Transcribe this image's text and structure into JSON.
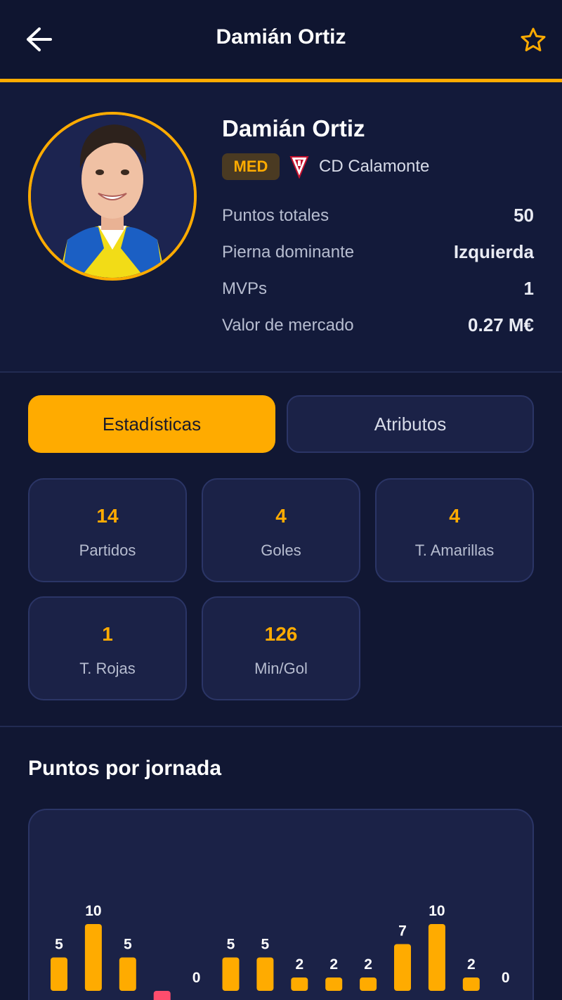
{
  "header": {
    "title": "Damián Ortiz",
    "back_icon": "arrow-left-icon",
    "favorite_icon": "star-outline-icon"
  },
  "profile": {
    "name": "Damián Ortiz",
    "position": "MED",
    "club": "CD Calamonte",
    "rows": [
      {
        "label": "Puntos totales",
        "value": "50"
      },
      {
        "label": "Pierna dominante",
        "value": "Izquierda"
      },
      {
        "label": "MVPs",
        "value": "1"
      },
      {
        "label": "Valor de mercado",
        "value": "0.27 M€"
      }
    ]
  },
  "tabs": [
    {
      "label": "Estadísticas",
      "active": true
    },
    {
      "label": "Atributos",
      "active": false
    }
  ],
  "stats": [
    {
      "value": "14",
      "label": "Partidos"
    },
    {
      "value": "4",
      "label": "Goles"
    },
    {
      "value": "4",
      "label": "T. Amarillas"
    },
    {
      "value": "1",
      "label": "T. Rojas"
    },
    {
      "value": "126",
      "label": "Min/Gol"
    }
  ],
  "points_section": {
    "title": "Puntos por jornada"
  },
  "colors": {
    "accent": "#ffab00",
    "negative": "#ff4d6d",
    "background": "#111733",
    "card": "#1b2247"
  },
  "chart_data": {
    "type": "bar",
    "title": "",
    "values": [
      5,
      10,
      5,
      -1,
      0,
      5,
      5,
      2,
      2,
      2,
      7,
      10,
      2,
      0
    ],
    "labels": [
      "5",
      "10",
      "5",
      "",
      "0",
      "5",
      "5",
      "2",
      "2",
      "2",
      "7",
      "10",
      "2",
      "0"
    ],
    "ylim": [
      -1,
      10
    ]
  }
}
